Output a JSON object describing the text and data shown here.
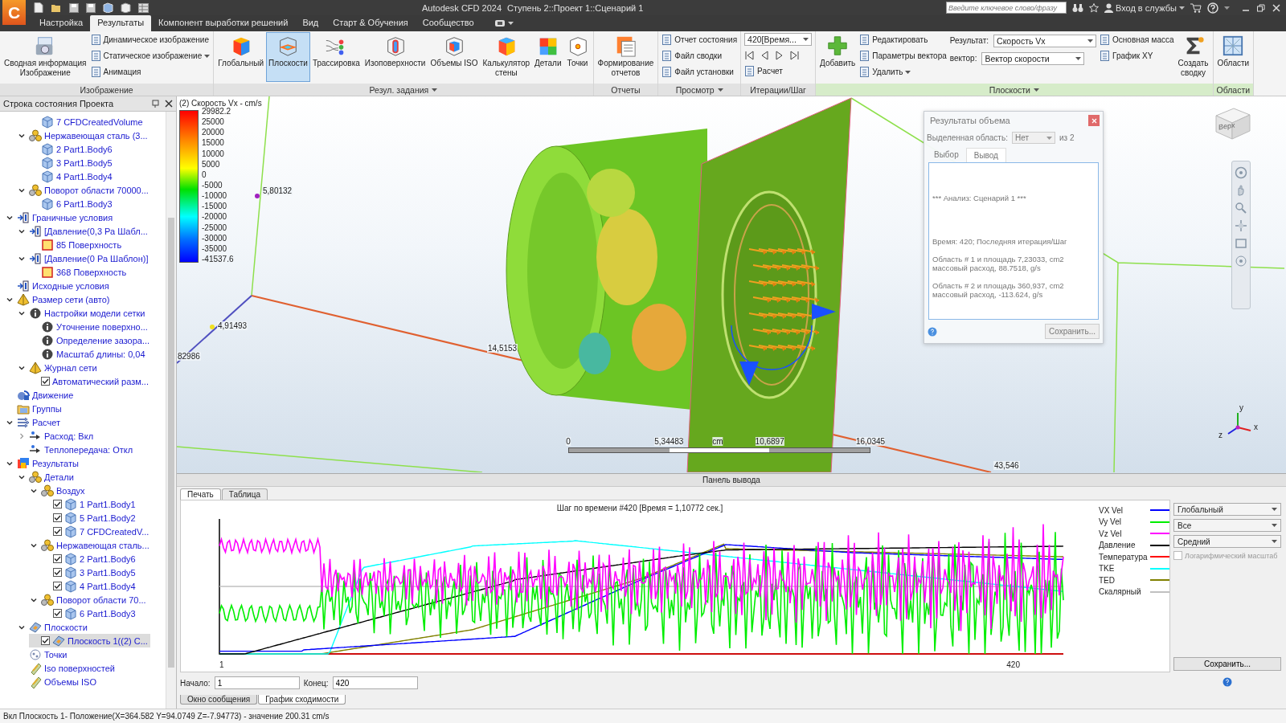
{
  "title_bar": {
    "logo": "C",
    "app_title": "Autodesk CFD 2024",
    "document_title": "Ступень 2::Проект 1::Сценарий 1",
    "search": {
      "placeholder": "Введите ключевое слово/фразу"
    },
    "sign_in": "Вход в службы"
  },
  "menu_tabs": [
    {
      "label": "Настройка",
      "selected": false
    },
    {
      "label": "Результаты",
      "selected": true
    },
    {
      "label": "Компонент выработки решений",
      "selected": false
    },
    {
      "label": "Вид",
      "selected": false
    },
    {
      "label": "Старт & Обучения",
      "selected": false
    },
    {
      "label": "Сообщество",
      "selected": false
    }
  ],
  "ribbon": {
    "groups": [
      {
        "title": "Изображение",
        "dropdown": false,
        "highlighted": false,
        "items": [
          {
            "kind": "large",
            "label": "Сводная информация\nИзображение",
            "selected": false
          },
          {
            "kind": "stack",
            "items": [
              {
                "kind": "small",
                "label": "Динамическое изображение",
                "dropdown": false
              },
              {
                "kind": "small",
                "label": "Статическое изображение",
                "dropdown": true
              },
              {
                "kind": "small",
                "label": "Анимация",
                "dropdown": false
              }
            ]
          }
        ]
      },
      {
        "title": "Резул. задания",
        "dropdown": true,
        "highlighted": false,
        "items": [
          {
            "kind": "large",
            "label": "Глобальный",
            "selected": false
          },
          {
            "kind": "large",
            "label": "Плоскости",
            "selected": true
          },
          {
            "kind": "large",
            "label": "Трассировка",
            "selected": false
          },
          {
            "kind": "large",
            "label": "Изоповерхности",
            "selected": false
          },
          {
            "kind": "large",
            "label": "Объемы ISO",
            "selected": false
          },
          {
            "kind": "large",
            "label": "Калькулятор\nстены",
            "selected": false
          },
          {
            "kind": "large",
            "label": "Детали",
            "selected": false
          },
          {
            "kind": "large",
            "label": "Точки",
            "selected": false
          }
        ]
      },
      {
        "title": "Отчеты",
        "dropdown": false,
        "highlighted": false,
        "items": [
          {
            "kind": "large",
            "label": "Формирование\nотчетов",
            "selected": false
          }
        ]
      },
      {
        "title": "Просмотр",
        "dropdown": true,
        "highlighted": false,
        "items": [
          {
            "kind": "stack",
            "items": [
              {
                "kind": "small",
                "label": "Отчет состояния",
                "dropdown": false
              },
              {
                "kind": "small",
                "label": "Файл сводки",
                "dropdown": false
              },
              {
                "kind": "small",
                "label": "Файл установки",
                "dropdown": false
              }
            ]
          }
        ]
      },
      {
        "title": "Итерации/Шаг",
        "dropdown": false,
        "highlighted": false,
        "items": [
          {
            "kind": "stack",
            "items": [
              {
                "kind": "select",
                "value": "420[Время..."
              },
              {
                "kind": "stepper"
              },
              {
                "kind": "small",
                "label": "Расчет",
                "dropdown": false
              }
            ]
          }
        ]
      },
      {
        "title": "Плоскости",
        "dropdown": true,
        "highlighted": true,
        "items": [
          {
            "kind": "add",
            "label": "Добавить",
            "selected": false
          },
          {
            "kind": "stack",
            "items": [
              {
                "kind": "small",
                "label": "Редактировать",
                "dropdown": false
              },
              {
                "kind": "small",
                "label": "Параметры вектора",
                "dropdown": false
              },
              {
                "kind": "small",
                "label": "Удалить",
                "dropdown": true
              }
            ]
          },
          {
            "kind": "stack",
            "items": [
              {
                "kind": "field",
                "label": "Результат:",
                "value": "Скорость Vx"
              },
              {
                "kind": "field",
                "label": "вектор:",
                "value": "Вектор скорости"
              }
            ]
          },
          {
            "kind": "stack",
            "items": [
              {
                "kind": "small",
                "label": "Основная масса",
                "dropdown": false
              },
              {
                "kind": "small",
                "label": "График XY",
                "dropdown": false
              }
            ]
          },
          {
            "kind": "sum",
            "label": "Создать\nсводку",
            "selected": false
          }
        ]
      },
      {
        "title": "Области",
        "dropdown": false,
        "highlighted": true,
        "items": [
          {
            "kind": "large",
            "label": "Области",
            "selected": false
          }
        ]
      }
    ]
  },
  "project_tree": {
    "title": "Строка состояния Проекта",
    "items": [
      {
        "children": [
          {
            "children": [
              {
                "label": "7 CFDCreatedVolume",
                "kind": "part",
                "selected": false
              }
            ]
          },
          {
            "label": "Нержавеющая сталь (3...",
            "kind": "material",
            "expanded": true,
            "selected": false,
            "children": [
              {
                "label": "2 Part1.Body6",
                "kind": "part",
                "selected": false
              },
              {
                "label": "3 Part1.Body5",
                "kind": "part",
                "selected": false
              },
              {
                "label": "4 Part1.Body4",
                "kind": "part",
                "selected": false
              }
            ]
          },
          {
            "label": "Поворот области 70000...",
            "kind": "material",
            "expanded": true,
            "selected": false,
            "children": [
              {
                "label": "6 Part1.Body3",
                "kind": "part",
                "selected": false
              }
            ]
          }
        ]
      },
      {
        "label": "Граничные условия",
        "kind": "boundary",
        "expanded": true,
        "selected": false,
        "children": [
          {
            "label": "[Давление(0,3 Ра Шабл...",
            "kind": "boundary",
            "expanded": true,
            "selected": false,
            "children": [
              {
                "label": "85 Поверхность",
                "kind": "surface",
                "selected": false
              }
            ]
          },
          {
            "label": "[Давление(0 Ра Шаблон)]",
            "kind": "boundary",
            "expanded": true,
            "selected": false,
            "children": [
              {
                "label": "368 Поверхность",
                "kind": "surface",
                "selected": false
              }
            ]
          }
        ]
      },
      {
        "label": "Исходные условия",
        "kind": "boundary",
        "selected": false
      },
      {
        "label": "Размер сети (авто)",
        "kind": "mesh",
        "expanded": true,
        "selected": false,
        "children": [
          {
            "label": "Настройки модели сетки",
            "kind": "info",
            "expanded": true,
            "selected": false,
            "children": [
              {
                "label": "Уточнение поверхно...",
                "kind": "info",
                "selected": false
              },
              {
                "label": "Определение зазора...",
                "kind": "info",
                "selected": false
              },
              {
                "label": "Масштаб длины: 0,04",
                "kind": "info",
                "selected": false
              }
            ]
          },
          {
            "label": "Журнал сети",
            "kind": "mesh",
            "expanded": true,
            "selected": false,
            "children": [
              {
                "label": "Автоматический разм...",
                "kind": "log",
                "checked": true,
                "selected": false
              }
            ]
          }
        ]
      },
      {
        "label": "Движение",
        "kind": "motion",
        "selected": false
      },
      {
        "label": "Группы",
        "kind": "groups",
        "selected": false
      },
      {
        "label": "Расчет",
        "kind": "solve",
        "expanded": true,
        "selected": false,
        "children": [
          {
            "label": "Расход: Вкл",
            "kind": "flow",
            "expanded": false,
            "selected": false
          },
          {
            "label": "Теплопередача: Откл",
            "kind": "flow",
            "selected": false
          }
        ]
      },
      {
        "label": "Результаты",
        "kind": "results",
        "expanded": true,
        "selected": false,
        "children": [
          {
            "label": "Детали",
            "kind": "material",
            "expanded": true,
            "selected": false,
            "children": [
              {
                "label": "Воздух",
                "kind": "material",
                "expanded": true,
                "selected": false,
                "children": [
                  {
                    "label": "1 Part1.Body1",
                    "kind": "part",
                    "checked": true,
                    "selected": false
                  },
                  {
                    "label": "5 Part1.Body2",
                    "kind": "part",
                    "checked": true,
                    "selected": false
                  },
                  {
                    "label": "7 CFDCreatedV...",
                    "kind": "part",
                    "checked": true,
                    "selected": false
                  }
                ]
              },
              {
                "label": "Нержавеющая сталь...",
                "kind": "material",
                "expanded": true,
                "selected": false,
                "children": [
                  {
                    "label": "2 Part1.Body6",
                    "kind": "part",
                    "checked": true,
                    "selected": false
                  },
                  {
                    "label": "3 Part1.Body5",
                    "kind": "part",
                    "checked": true,
                    "selected": false
                  },
                  {
                    "label": "4 Part1.Body4",
                    "kind": "part",
                    "checked": true,
                    "selected": false
                  }
                ]
              },
              {
                "label": "Поворот области 70...",
                "kind": "material",
                "expanded": true,
                "selected": false,
                "children": [
                  {
                    "label": "6 Part1.Body3",
                    "kind": "part",
                    "checked": true,
                    "selected": false
                  }
                ]
              }
            ]
          },
          {
            "label": "Плоскости",
            "kind": "plane",
            "expanded": true,
            "selected": false,
            "children": [
              {
                "label": "Плоскость 1((2) С...",
                "kind": "plane",
                "checked": true,
                "selected": true
              }
            ]
          },
          {
            "label": "Точки",
            "kind": "points",
            "selected": false
          },
          {
            "label": "Iso поверхностей",
            "kind": "iso",
            "selected": false
          },
          {
            "label": "Объемы ISO",
            "kind": "iso",
            "selected": false
          }
        ]
      }
    ]
  },
  "viewport": {
    "legend": {
      "title": "(2) Скорость Vx - cm/s",
      "labels": [
        "29982.2",
        "25000",
        "20000",
        "15000",
        "10000",
        "5000",
        "0",
        "-5000",
        "-10000",
        "-15000",
        "-20000",
        "-25000",
        "-30000",
        "-35000",
        "-41537.6"
      ]
    },
    "axis_labels": [
      "5,80132",
      "4,91493",
      "82986",
      "14,5153",
      "43,546"
    ],
    "ruler": {
      "labels": [
        "0",
        "5,34483",
        "10,6897",
        "16,0345"
      ],
      "unit": "cm"
    },
    "view_cube": {
      "label": "Верх"
    },
    "triad": {
      "x": "x",
      "y": "y",
      "z": "z"
    }
  },
  "volume_results_dialog": {
    "title": "Результаты объема",
    "region_label": "Выделенная область:",
    "region_value": "Нет",
    "region_count": "из 2",
    "tabs": [
      {
        "label": "Выбор",
        "selected": false
      },
      {
        "label": "Вывод",
        "selected": true
      }
    ],
    "output": [
      [
        "*** Анализ: Сценарий 1 ***"
      ],
      [
        "Время: 420; Последняя итерация/Шаг"
      ],
      [
        "Область # 1 и площадь 7,23033, cm2",
        "массовый расход, 88.7518, g/s"
      ],
      [
        "Область # 2 и площадь 360,937, cm2",
        "массовый расход, -113.624, g/s"
      ]
    ],
    "save_button": "Сохранить..."
  },
  "output_panel": {
    "title": "Панель вывода",
    "tabs": [
      {
        "label": "Печать",
        "selected": true
      },
      {
        "label": "Таблица",
        "selected": false
      }
    ],
    "chart": {
      "title": "Шаг по времени #420 [Время = 1,10772 сек.]",
      "x_start": "1",
      "x_end": "420",
      "legend": [
        {
          "label": "VX Vel",
          "color": "#0000ff"
        },
        {
          "label": "Vy Vel",
          "color": "#00ee00"
        },
        {
          "label": "Vz Vel",
          "color": "#ff00ff"
        },
        {
          "label": "Давление",
          "color": "#000000"
        },
        {
          "label": "Температура",
          "color": "#ff0000"
        },
        {
          "label": "TKE",
          "color": "#00ffff"
        },
        {
          "label": "TED",
          "color": "#808000"
        },
        {
          "label": "Скалярный",
          "color": "#c0c0c0"
        }
      ]
    },
    "selects": [
      "Глобальный",
      "Все",
      "Средний"
    ],
    "log_scale": {
      "label": "Логарифмический масштаб",
      "checked": false,
      "disabled": true
    },
    "save_button": "Сохранить...",
    "start": {
      "label": "Начало:",
      "value": "1"
    },
    "end": {
      "label": "Конец:",
      "value": "420"
    },
    "bottom_tabs": [
      {
        "label": "Окно сообщения",
        "selected": false
      },
      {
        "label": "График сходимости",
        "selected": true
      }
    ]
  },
  "status_bar": {
    "text": "Вкл Плоскость 1- Положение(X=364.582 Y=94.0749 Z=-7.94773) - значение 200.31 cm/s"
  }
}
